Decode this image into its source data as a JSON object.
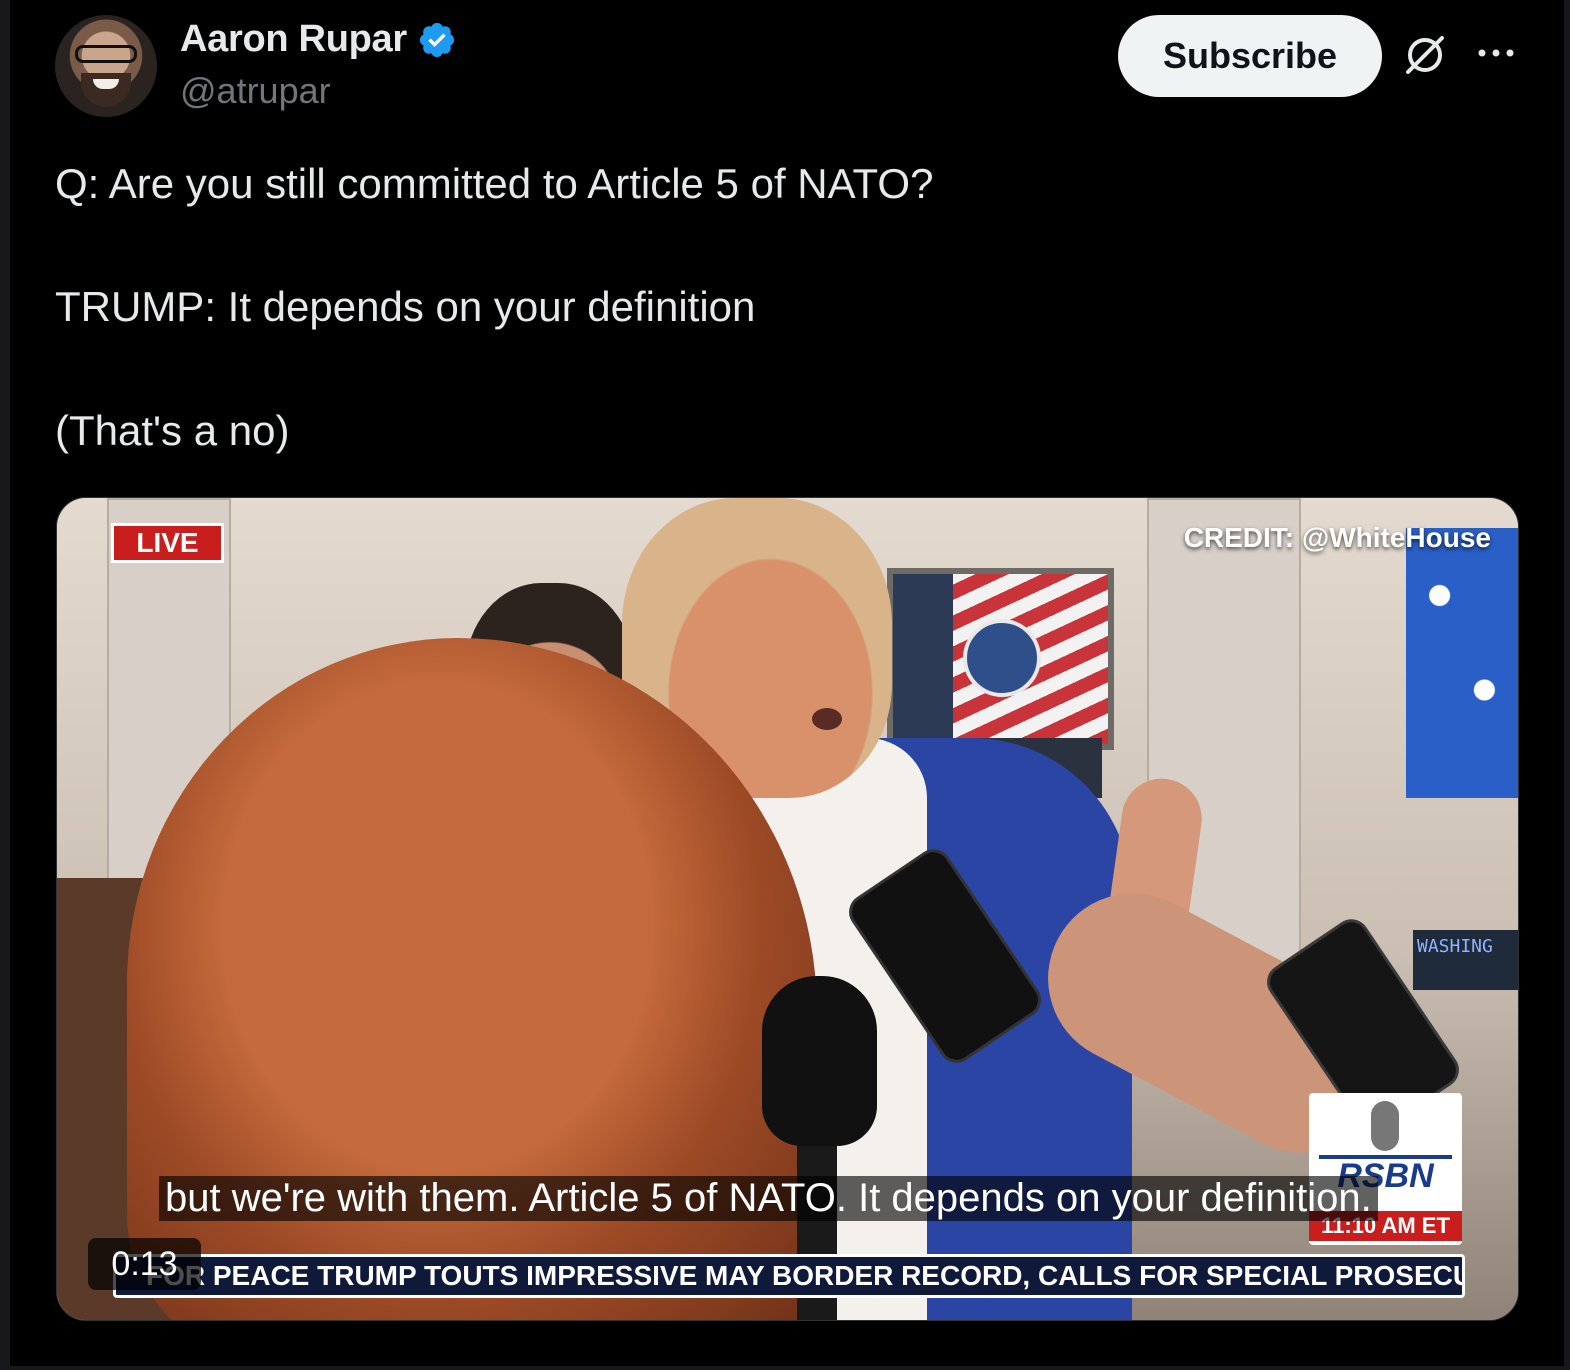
{
  "author": {
    "display_name": "Aaron Rupar",
    "handle": "@atrupar",
    "verified_icon": "verified-badge-icon",
    "avatar_icon": "avatar-photo"
  },
  "actions": {
    "subscribe_label": "Subscribe",
    "grok_icon": "grok-icon",
    "more_icon": "more-options-icon"
  },
  "tweet": {
    "lines": [
      "Q: Are you still committed to Article 5 of NATO?",
      "TRUMP: It depends on your definition",
      "(That's a no)"
    ]
  },
  "video": {
    "live_label": "LIVE",
    "credit": "CREDIT: @WhiteHouse",
    "monitor_text": "WASHING",
    "caption": "but we're with them. Article 5 of NATO. It depends on your definition.",
    "timecode": "0:13",
    "ticker": "FOR PEACE     TRUMP TOUTS IMPRESSIVE MAY BORDER RECORD, CALLS FOR SPECIAL PROSECUT",
    "network_logo": "RSBN",
    "network_time": "11:10 AM ET"
  },
  "colors": {
    "background": "#000000",
    "text_primary": "#e7e9ea",
    "text_secondary": "#71767b",
    "verified_blue": "#1d9bf0",
    "live_red": "#c81e1e"
  }
}
